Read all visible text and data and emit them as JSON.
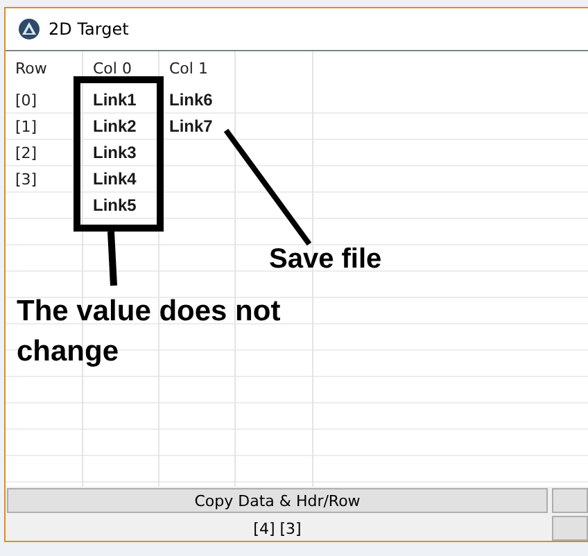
{
  "window": {
    "title": "2D Target"
  },
  "table": {
    "columns": [
      "Row",
      "Col 0",
      "Col 1"
    ],
    "rows": [
      {
        "cells": [
          "[0]",
          "Link1",
          "Link6"
        ]
      },
      {
        "cells": [
          "[1]",
          "Link2",
          "Link7"
        ]
      },
      {
        "cells": [
          "[2]",
          "Link3"
        ]
      },
      {
        "cells": [
          "[3]",
          "Link4"
        ]
      },
      {
        "cells": [
          "",
          "Link5"
        ]
      }
    ]
  },
  "copy_button": "Copy Data & Hdr/Row",
  "status": "[4] [3]",
  "annotations": {
    "arrow_note": "Save file",
    "box_note": "The value does not change"
  }
}
